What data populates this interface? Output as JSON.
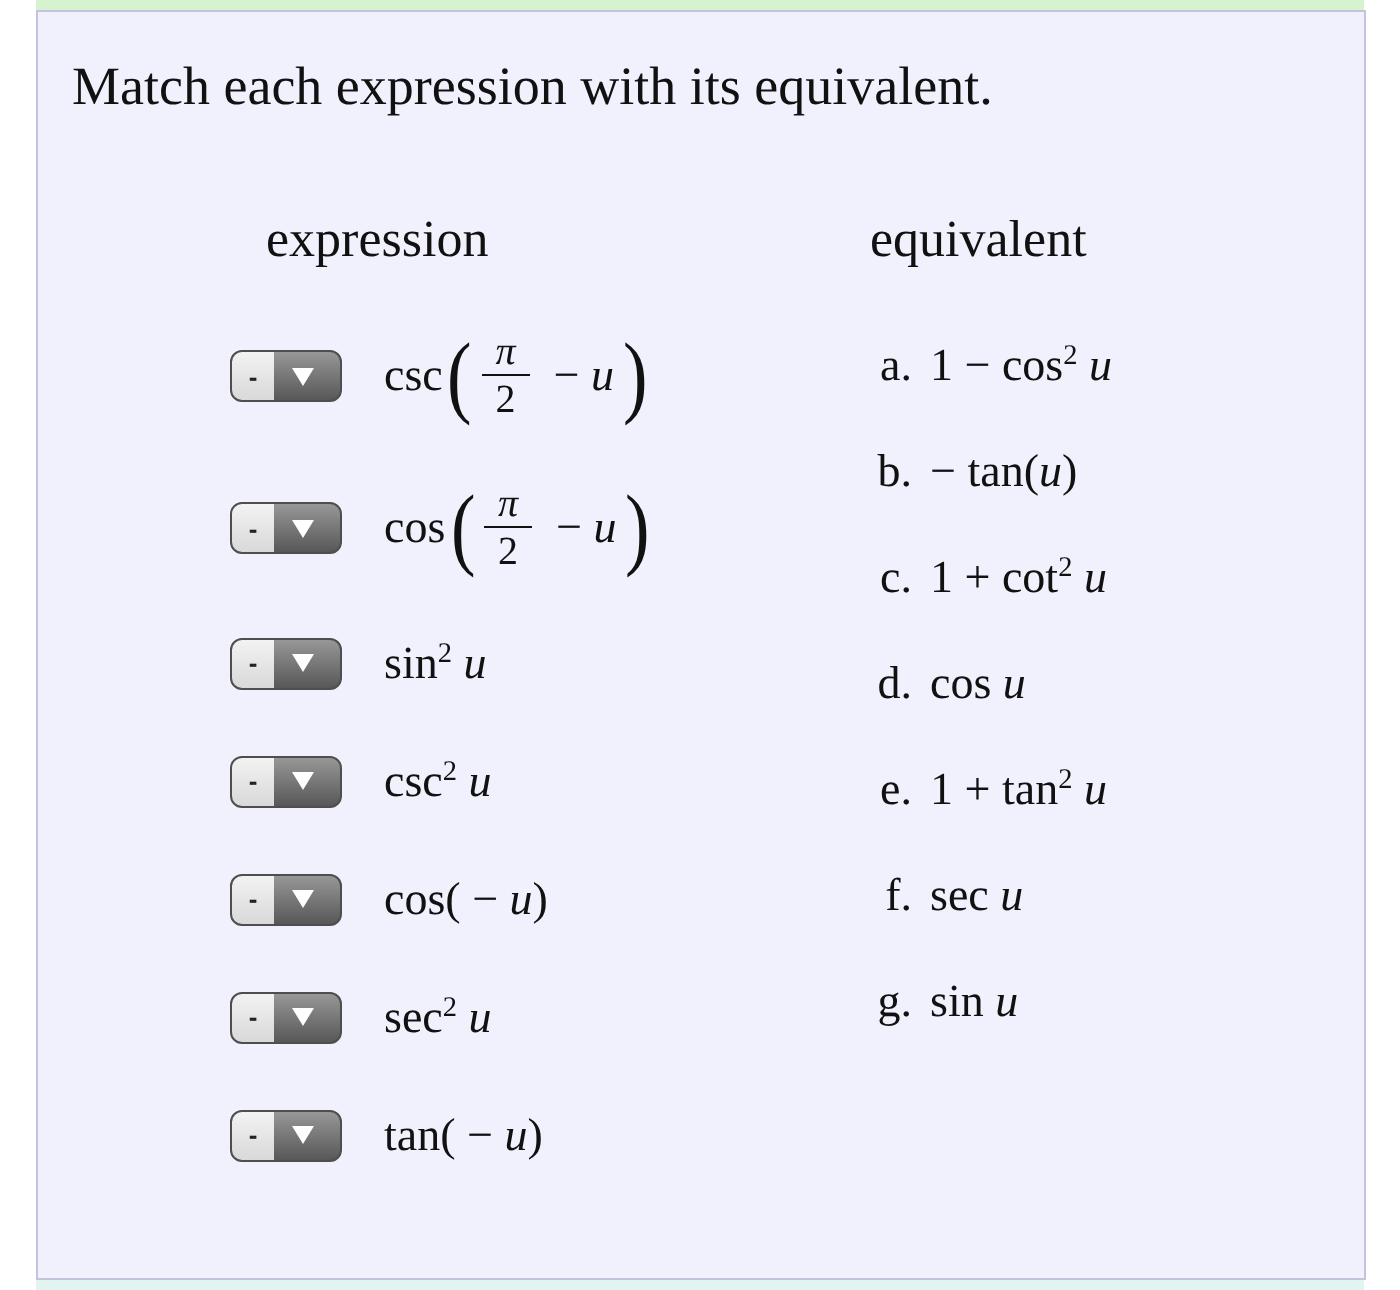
{
  "instruction": "Match each expression with its equivalent.",
  "headers": {
    "left": "expression",
    "right": "equivalent"
  },
  "expressions": [
    {
      "kind": "fraction",
      "value": "-",
      "func": "csc",
      "open": "(",
      "numerator": "π",
      "denominator": "2",
      "rest": "− *u*",
      "close": ")"
    },
    {
      "kind": "fraction",
      "value": "-",
      "func": "cos",
      "open": "(",
      "numerator": "π",
      "denominator": "2",
      "rest": "− *u*",
      "close": ")"
    },
    {
      "kind": "inline",
      "value": "-",
      "text": "sin$^{2}$ *u*"
    },
    {
      "kind": "inline",
      "value": "-",
      "text": "csc$^{2}$ *u*"
    },
    {
      "kind": "inline",
      "value": "-",
      "text": "cos( − *u*)"
    },
    {
      "kind": "inline",
      "value": "-",
      "text": "sec$^{2}$ *u*"
    },
    {
      "kind": "inline",
      "value": "-",
      "text": "tan( − *u*)"
    }
  ],
  "equivalents": [
    {
      "letter": "a.",
      "text": "1 − cos$^{2}$ *u*"
    },
    {
      "letter": "b.",
      "text": "− tan(*u*)"
    },
    {
      "letter": "c.",
      "text": "1 + cot$^{2}$ *u*"
    },
    {
      "letter": "d.",
      "text": "cos *u*"
    },
    {
      "letter": "e.",
      "text": "1 + tan$^{2}$ *u*"
    },
    {
      "letter": "f.",
      "text": "sec *u*"
    },
    {
      "letter": "g.",
      "text": "sin *u*"
    }
  ]
}
